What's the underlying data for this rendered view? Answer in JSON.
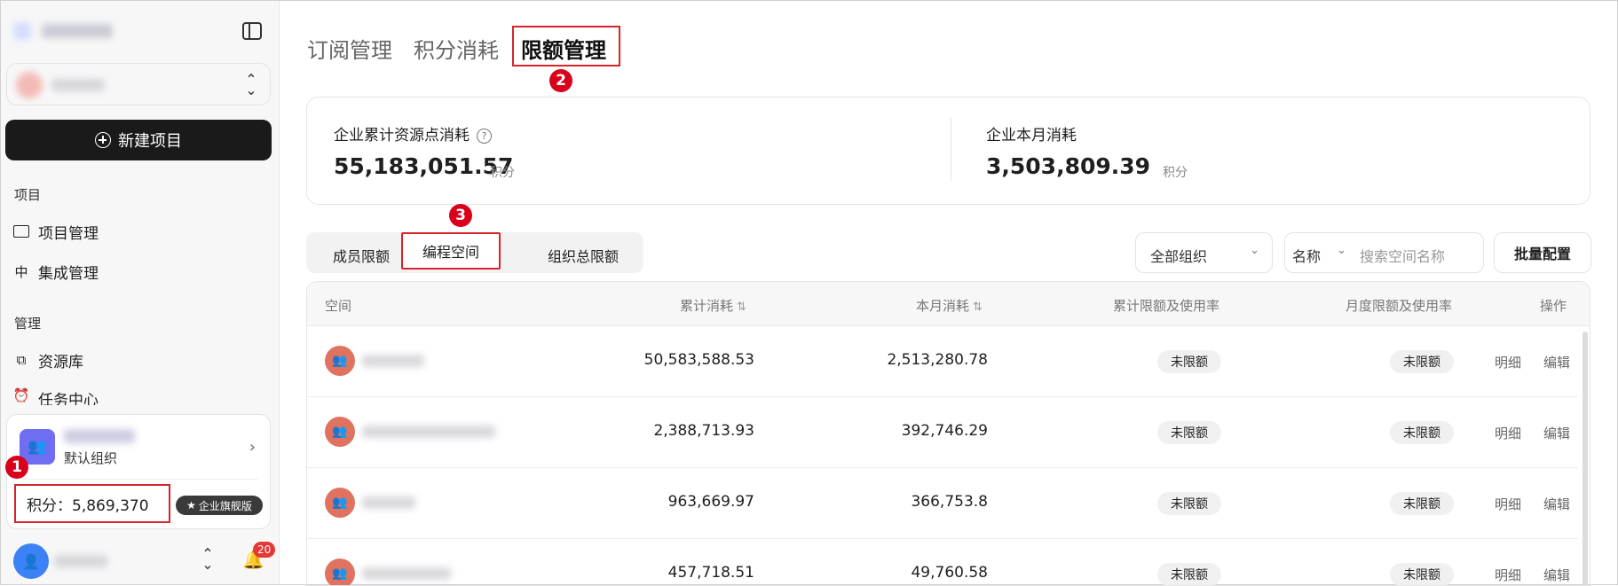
{
  "sidebar": {
    "new_project_label": "新建项目",
    "section_project": "项目",
    "nav_project_mgmt": "项目管理",
    "nav_integration_mgmt": "集成管理",
    "section_manage": "管理",
    "nav_resource_lib": "资源库",
    "nav_task_center": "任务中心",
    "org_subtitle": "默认组织",
    "credits_label": "积分：5,869,370",
    "plan_badge": "企业旗舰版",
    "notification_count": "20"
  },
  "markers": [
    "1",
    "2",
    "3"
  ],
  "top_tabs": [
    "订阅管理",
    "积分消耗",
    "限额管理"
  ],
  "active_top_tab": "限额管理",
  "stats": {
    "total_label": "企业累计资源点消耗",
    "total_value": "55,183,051.57",
    "total_unit": "积分",
    "month_label": "企业本月消耗",
    "month_value": "3,503,809.39",
    "month_unit": "积分"
  },
  "segments": [
    "成员限额",
    "编程空间",
    "组织总限额"
  ],
  "active_segment": "编程空间",
  "filters": {
    "org_select": "全部组织",
    "field_select": "名称",
    "search_placeholder": "搜索空间名称",
    "batch_button": "批量配置"
  },
  "table": {
    "headers": {
      "space": "空间",
      "total": "累计消耗",
      "month": "本月消耗",
      "total_limit": "累计限额及使用率",
      "month_limit": "月度限额及使用率",
      "ops": "操作"
    },
    "rows": [
      {
        "total": "50,583,588.53",
        "month": "2,513,280.78",
        "total_limit": "未限额",
        "month_limit": "未限额",
        "detail": "明细",
        "edit": "编辑"
      },
      {
        "total": "2,388,713.93",
        "month": "392,746.29",
        "total_limit": "未限额",
        "month_limit": "未限额",
        "detail": "明细",
        "edit": "编辑"
      },
      {
        "total": "963,669.97",
        "month": "366,753.8",
        "total_limit": "未限额",
        "month_limit": "未限额",
        "detail": "明细",
        "edit": "编辑"
      },
      {
        "total": "457,718.51",
        "month": "49,760.58",
        "total_limit": "未限额",
        "month_limit": "未限额",
        "detail": "明细",
        "edit": "编辑"
      }
    ]
  },
  "colors": {
    "accent": "#d8232a",
    "primary_button": "#1a1a1a",
    "row_avatar": "#e0735f"
  }
}
